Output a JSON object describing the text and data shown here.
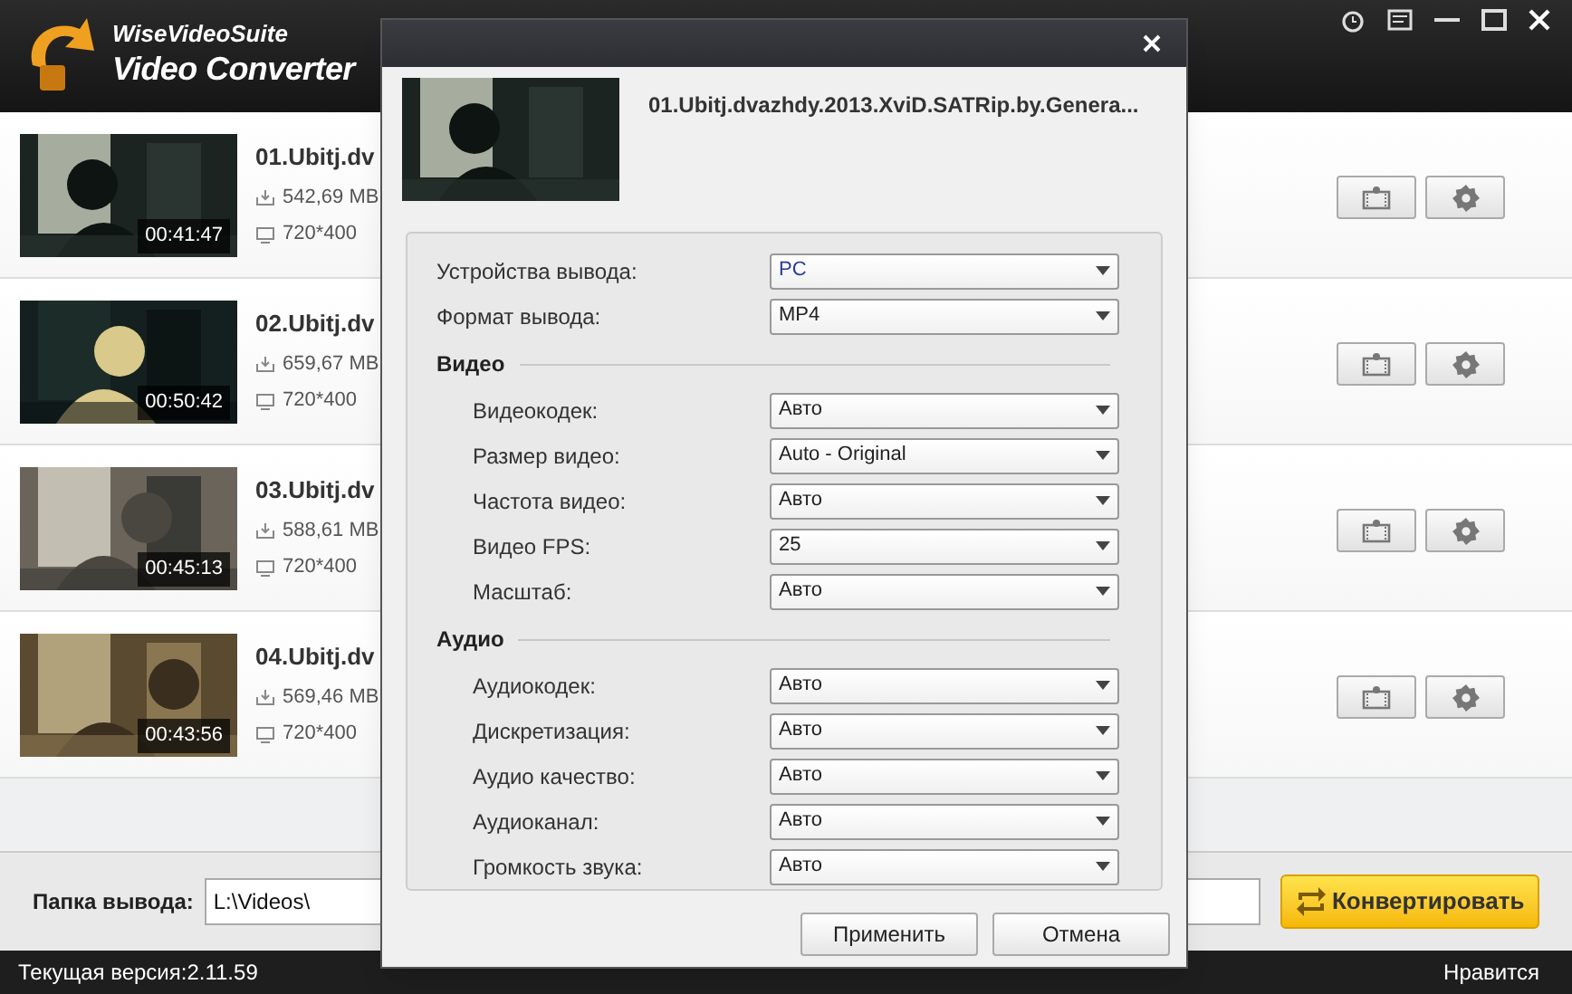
{
  "app": {
    "brand": "WiseVideoSuite",
    "title": "Video Converter"
  },
  "videos": [
    {
      "name": "01.Ubitj.dv",
      "size": "542,69 MB",
      "resolution": "720*400",
      "duration": "00:41:47"
    },
    {
      "name": "02.Ubitj.dv",
      "size": "659,67 MB",
      "resolution": "720*400",
      "duration": "00:50:42"
    },
    {
      "name": "03.Ubitj.dv",
      "size": "588,61 MB",
      "resolution": "720*400",
      "duration": "00:45:13"
    },
    {
      "name": "04.Ubitj.dv",
      "size": "569,46 MB",
      "resolution": "720*400",
      "duration": "00:43:56"
    }
  ],
  "output": {
    "label": "Папка вывода:",
    "value": "L:\\Videos\\"
  },
  "convert_button": "Конвертировать",
  "status_bar": {
    "version": "Текущая версия:2.11.59",
    "like": "Нравится"
  },
  "dialog": {
    "file_name": "01.Ubitj.dvazhdy.2013.XviD.SATRip.by.Genera...",
    "settings": [
      {
        "kind": "select",
        "label": "Устройства вывода:",
        "value": "PC",
        "focused": true
      },
      {
        "kind": "select",
        "label": "Формат вывода:",
        "value": "MP4",
        "focused": false
      },
      {
        "kind": "section",
        "title": "Видео",
        "children": [
          {
            "kind": "select",
            "label": "Видеокодек:",
            "value": "Авто",
            "focused": false
          },
          {
            "kind": "select",
            "label": "Размер видео:",
            "value": "Auto - Original",
            "focused": false
          },
          {
            "kind": "select",
            "label": "Частота видео:",
            "value": "Авто",
            "focused": false
          },
          {
            "kind": "select",
            "label": "Видео FPS:",
            "value": "25",
            "focused": false
          },
          {
            "kind": "select",
            "label": "Масштаб:",
            "value": "Авто",
            "focused": false
          }
        ]
      },
      {
        "kind": "section",
        "title": "Аудио",
        "children": [
          {
            "kind": "select",
            "label": "Аудиокодек:",
            "value": "Авто",
            "focused": false
          },
          {
            "kind": "select",
            "label": "Дискретизация:",
            "value": "Авто",
            "focused": false
          },
          {
            "kind": "select",
            "label": "Аудио качество:",
            "value": "Авто",
            "focused": false
          },
          {
            "kind": "select",
            "label": "Аудиоканал:",
            "value": "Авто",
            "focused": false
          },
          {
            "kind": "select",
            "label": "Громкость звука:",
            "value": "Авто",
            "focused": false
          }
        ]
      }
    ],
    "buttons": [
      "Применить",
      "Отмена"
    ]
  }
}
